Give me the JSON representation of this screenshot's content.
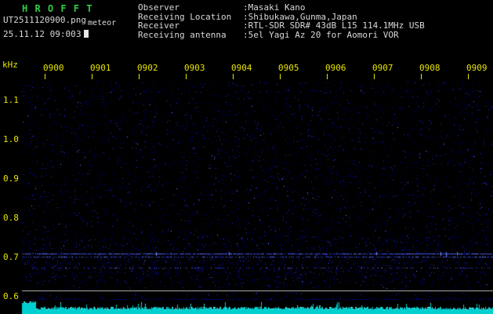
{
  "app": {
    "title": "H R O F F T"
  },
  "file_info": {
    "filename": "UT2511120900.png",
    "mode_label": "meteor",
    "datetime": "25.11.12 09:00",
    "count": "3"
  },
  "station": {
    "fields": [
      {
        "label": "Observer",
        "value": ":Masaki Kano"
      },
      {
        "label": "Receiving Location",
        "value": ":Shibukawa,Gunma,Japan"
      },
      {
        "label": "Receiver",
        "value": ":RTL-SDR SDR# 43dB L15 114.1MHz USB"
      },
      {
        "label": "Receiving antenna",
        "value": ":5el Yagi Az 20 for Aomori VOR"
      }
    ]
  },
  "chart_data": {
    "type": "heatmap",
    "title": "HROFFT 10-minute meteor-scatter spectrogram",
    "ylabel": "kHz",
    "y_ticks": [
      "1.1",
      "1.0",
      "0.9",
      "0.8",
      "0.7",
      "0.6"
    ],
    "y_range_khz": [
      0.55,
      1.15
    ],
    "x_ticks": [
      "0900",
      "0901",
      "0902",
      "0903",
      "0904",
      "0905",
      "0906",
      "0907",
      "0908",
      "0909"
    ],
    "x_axis": "time UT (hhmm), 1-minute steps",
    "grid": false,
    "carrier_lines": [
      {
        "khz": 0.708,
        "density": 0.8
      },
      {
        "khz": 0.7,
        "density": 0.45
      },
      {
        "khz": 0.672,
        "density": 0.22
      }
    ],
    "baseline_khz": 0.614,
    "noise": "sparse dark-blue speckle over black, slightly denser below 0.75 kHz",
    "amplitude_strip": "cyan signal-level trace along bottom edge",
    "colors": {
      "background": "#000000",
      "axis_text": "#e8e400",
      "title_green": "#33cc44",
      "header_text": "#d8d8d8",
      "noise_dim": "#000096",
      "noise_mid": "#2433cc",
      "noise_bright": "#7788ff",
      "carrier": "#3c50e6",
      "baseline_white": "#b8b8b8",
      "amplitude_cyan": "#00cfcf",
      "amplitude_bright": "#90f8f8"
    }
  }
}
